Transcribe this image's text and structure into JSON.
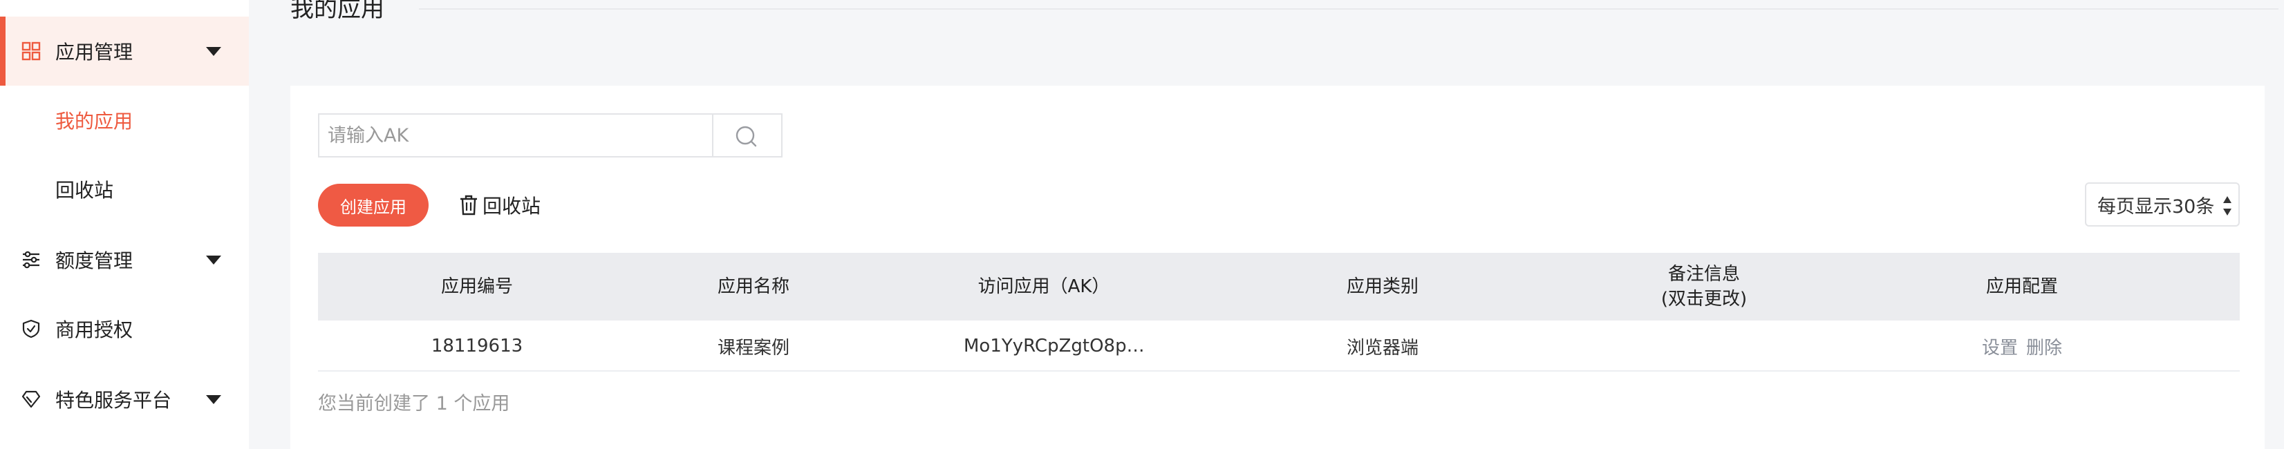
{
  "sidebar": {
    "items": [
      {
        "label": "应用管理",
        "icon": "grid-icon"
      },
      {
        "label": "额度管理",
        "icon": "sliders-icon"
      },
      {
        "label": "商用授权",
        "icon": "shield-check-icon"
      },
      {
        "label": "特色服务平台",
        "icon": "diamond-icon"
      }
    ],
    "subitems": [
      {
        "label": "我的应用"
      },
      {
        "label": "回收站"
      }
    ]
  },
  "page": {
    "title": "我的应用"
  },
  "search": {
    "placeholder": "请输入AK",
    "value": ""
  },
  "toolbar": {
    "create_label": "创建应用",
    "recycle_label": "回收站",
    "page_size_label": "每页显示30条"
  },
  "table": {
    "headers": [
      "应用编号",
      "应用名称",
      "访问应用（AK）",
      "应用类别",
      "备注信息",
      "(双击更改)",
      "应用配置"
    ],
    "rows": [
      {
        "id": "18119613",
        "name": "课程案例",
        "ak": "Mo1YyRCpZgtO8p…",
        "category": "浏览器端",
        "note": "",
        "actions": [
          "设置",
          "删除"
        ]
      }
    ]
  },
  "footer": {
    "count_text": "您当前创建了 1 个应用"
  },
  "colors": {
    "accent": "#ef5a44",
    "active_bg": "#fdf0ec",
    "table_head_bg": "#ebecef"
  }
}
